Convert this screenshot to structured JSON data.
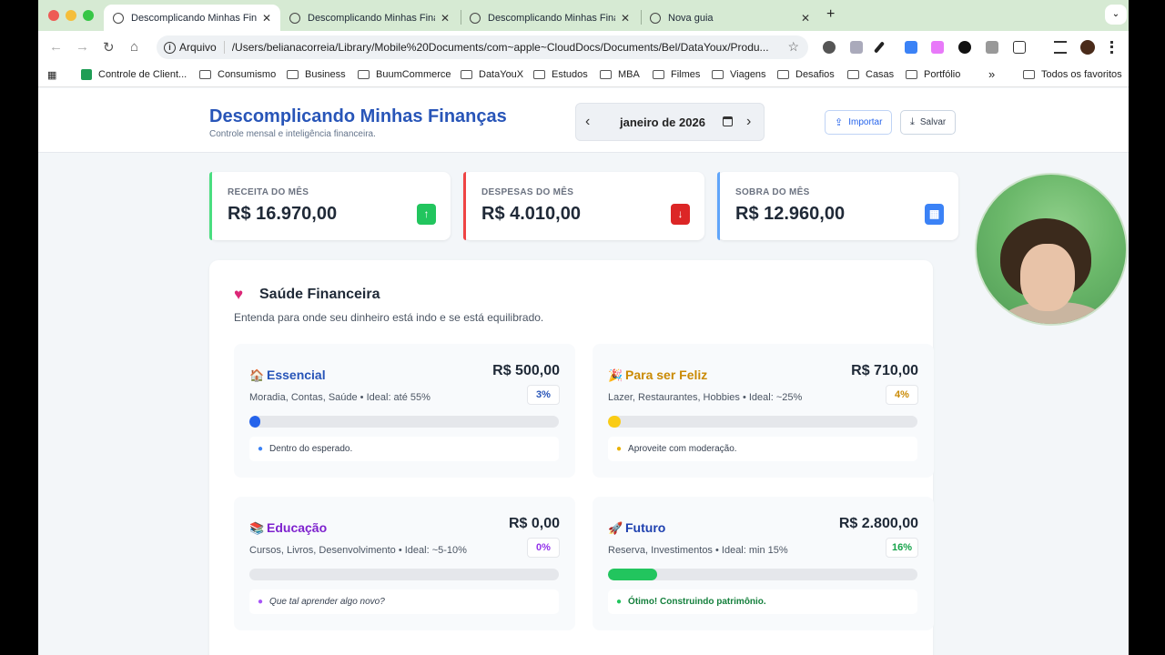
{
  "browser": {
    "tabs": [
      {
        "label": "Descomplicando Minhas Fina",
        "active": true
      },
      {
        "label": "Descomplicando Minhas Fina",
        "active": false
      },
      {
        "label": "Descomplicando Minhas Fina",
        "active": false
      },
      {
        "label": "Nova guia",
        "active": false
      }
    ],
    "tab_close": "✕",
    "new_tab": "+",
    "tab_menu": "⌄",
    "nav": {
      "back": "←",
      "forward": "→",
      "reload": "↻",
      "home": "⌂"
    },
    "address": {
      "info_icon": "i",
      "chip": "Arquivo",
      "url": "/Users/belianacorreia/Library/Mobile%20Documents/com~apple~CloudDocs/Documents/Bel/DataYoux/Produ...",
      "star": "☆"
    },
    "bookmarks": [
      {
        "label": "Controle de Client...",
        "icon": "sheets-icon"
      },
      {
        "label": "Consumismo",
        "icon": "folder-icon"
      },
      {
        "label": "Business",
        "icon": "folder-icon"
      },
      {
        "label": "BuumCommerce",
        "icon": "folder-icon"
      },
      {
        "label": "DataYouX",
        "icon": "folder-icon"
      },
      {
        "label": "Estudos",
        "icon": "folder-icon"
      },
      {
        "label": "MBA",
        "icon": "folder-icon"
      },
      {
        "label": "Filmes",
        "icon": "folder-icon"
      },
      {
        "label": "Viagens",
        "icon": "folder-icon"
      },
      {
        "label": "Desafios",
        "icon": "folder-icon"
      },
      {
        "label": "Casas",
        "icon": "folder-icon"
      },
      {
        "label": "Portfólio",
        "icon": "folder-icon"
      }
    ],
    "bookmarks_more": "»",
    "all_bookmarks": "Todos os favoritos"
  },
  "app": {
    "title": "Descomplicando Minhas Finanças",
    "subtitle": "Controle mensal e inteligência financeira.",
    "month": "janeiro de 2026",
    "prev": "‹",
    "next": "›",
    "import_label": "Importar",
    "save_label": "Salvar"
  },
  "stats": [
    {
      "label": "RECEITA DO MÊS",
      "value": "R$ 16.970,00",
      "icon": "↑",
      "color": "#22c55e"
    },
    {
      "label": "DESPESAS DO MÊS",
      "value": "R$ 4.010,00",
      "icon": "↓",
      "color": "#dc2626"
    },
    {
      "label": "SOBRA DO MÊS",
      "value": "R$ 12.960,00",
      "icon": "▦",
      "color": "#3b82f6"
    }
  ],
  "health": {
    "icon": "♥",
    "title": "Saúde Financeira",
    "subtitle": "Entenda para onde seu dinheiro está indo e se está equilibrado.",
    "categories": [
      {
        "emoji": "🏠",
        "name": "Essencial",
        "desc": "Moradia, Contas, Saúde • Ideal: até 55%",
        "amount": "R$ 500,00",
        "pct": "3%",
        "fill": 0.03,
        "color": "#2855b8",
        "note": "Dentro do esperado.",
        "note_color": "#3b82f6"
      },
      {
        "emoji": "🎉",
        "name": "Para ser Feliz",
        "desc": "Lazer, Restaurantes, Hobbies • Ideal: ~25%",
        "amount": "R$ 710,00",
        "pct": "4%",
        "fill": 0.04,
        "color": "#ca8a04",
        "note": "Aproveite com moderação.",
        "note_color": "#eab308"
      },
      {
        "emoji": "📚",
        "name": "Educação",
        "desc": "Cursos, Livros, Desenvolvimento • Ideal: ~5-10%",
        "amount": "R$ 0,00",
        "pct": "0%",
        "fill": 0,
        "color": "#7e22ce",
        "note": "Que tal aprender algo novo?",
        "note_color": "#a855f7"
      },
      {
        "emoji": "🚀",
        "name": "Futuro",
        "desc": "Reserva, Investimentos • Ideal: min 15%",
        "amount": "R$ 2.800,00",
        "pct": "16%",
        "fill": 0.16,
        "color": "#1e40af",
        "note": "Ótimo! Construindo patrimônio.",
        "note_color": "#22c55e"
      }
    ]
  }
}
